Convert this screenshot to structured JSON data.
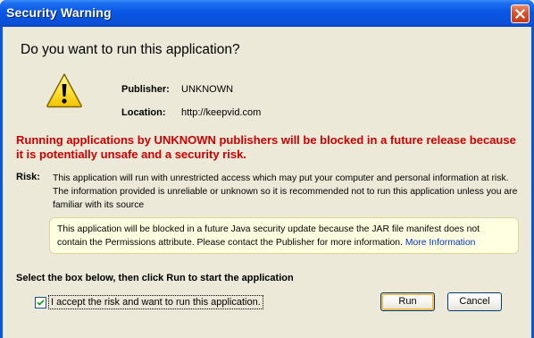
{
  "window": {
    "title": "Security Warning"
  },
  "dialog": {
    "heading": "Do you want to run this application?",
    "publisher_label": "Publisher:",
    "publisher_value": "UNKNOWN",
    "location_label": "Location:",
    "location_value": "http://keepvid.com",
    "warning_text": "Running applications by UNKNOWN publishers will be blocked in a future release because it is potentially unsafe and a security risk.",
    "risk_label": "Risk:",
    "risk_text": "This application will run with unrestricted access which may put your computer and personal information at risk. The information provided is unreliable or unknown so it is recommended not to run this application unless you are familiar with its source",
    "notice_text": "This application will be blocked in a future Java security update because the JAR file manifest does not contain the Permissions attribute. Please contact the Publisher for more information.",
    "notice_link": "More Information",
    "instruction": "Select the box below, then click Run to start the application",
    "checkbox_label": "I accept the risk and want to run this application.",
    "checkbox_checked": true,
    "run_label": "Run",
    "cancel_label": "Cancel"
  },
  "icons": {
    "warning": "warning-triangle-icon",
    "close": "close-icon",
    "check": "checkmark-icon"
  },
  "colors": {
    "title_bar": "#0a55e0",
    "dialog_bg": "#ece9d8",
    "warning_red": "#cc0000",
    "notice_bg": "#ffffe1",
    "link_blue": "#0033cc",
    "close_red": "#d9512d"
  }
}
